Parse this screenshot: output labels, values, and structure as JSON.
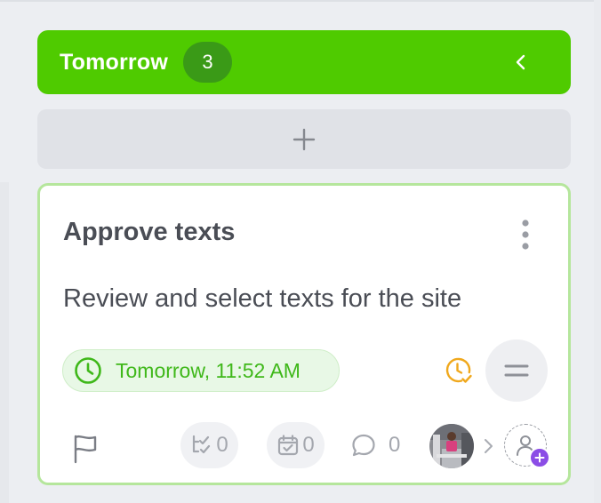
{
  "column": {
    "title": "Tomorrow",
    "count": "3",
    "collapse_icon": "chevron-left-icon",
    "color": "#4fcb00"
  },
  "add_task": {
    "icon": "plus-icon"
  },
  "card": {
    "title": "Approve texts",
    "description": "Review and select texts for the site",
    "due": "Tomorrow, 11:52 AM",
    "due_color": "#3fb81a",
    "snooze_color": "#f0a81c",
    "priority_icon": "equals-icon",
    "footer": {
      "subtasks_count": "0",
      "checklist_count": "0",
      "comments_count": "0"
    }
  }
}
